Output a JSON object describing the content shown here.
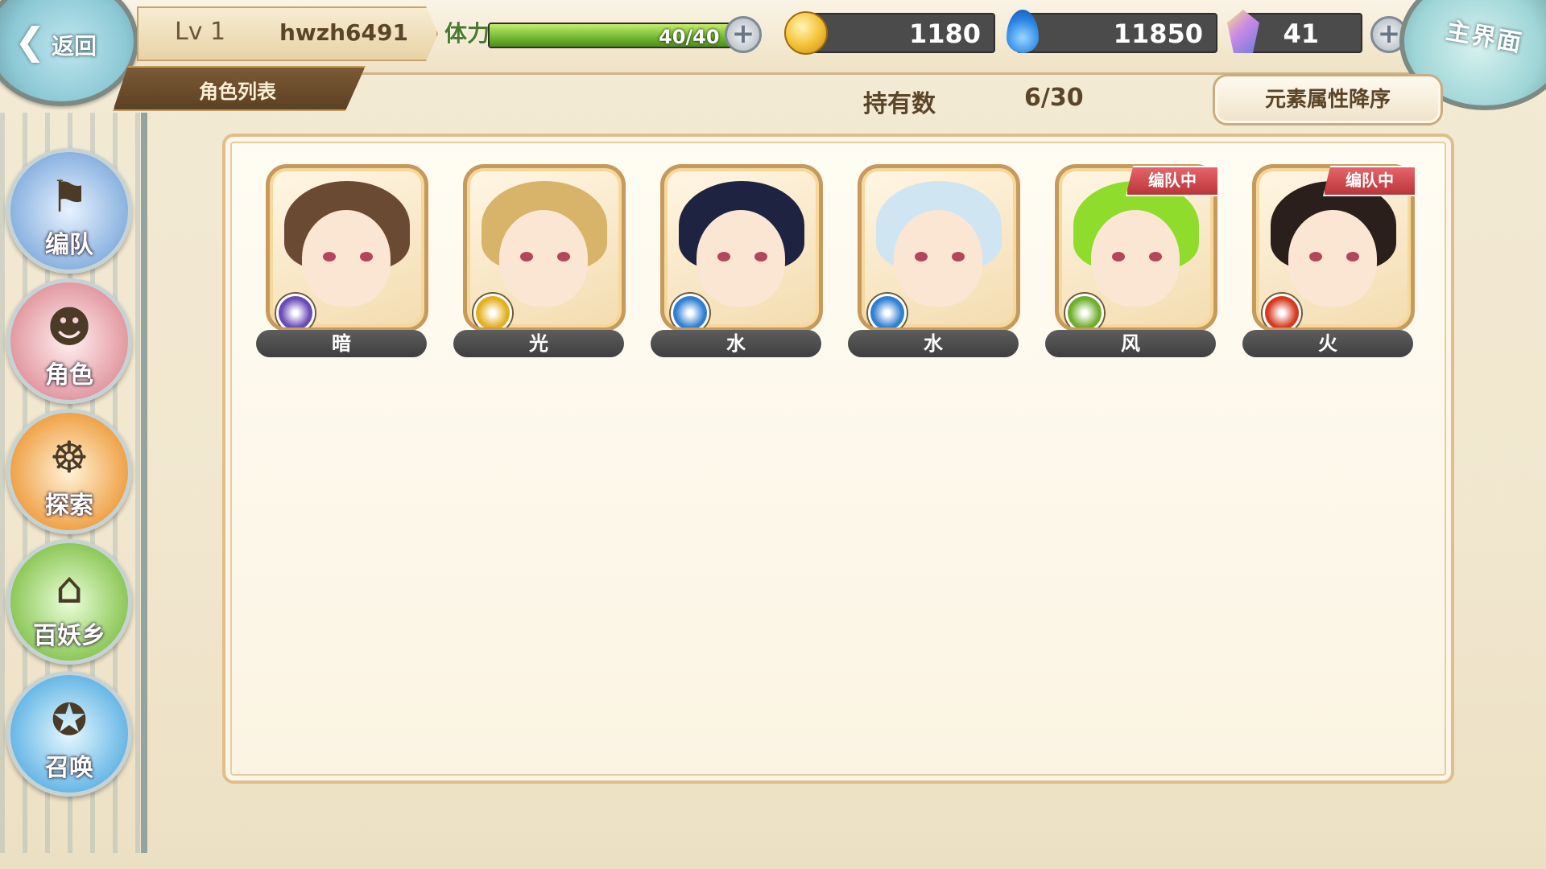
{
  "header": {
    "back_label": "返回",
    "home_label": "主界面",
    "level": "Lv 1",
    "username": "hwzh6491",
    "page_title": "角色列表",
    "stamina_label": "体力",
    "stamina_text": "40/40",
    "stamina_fraction": 1.0,
    "gold": "1180",
    "soul": "11850",
    "crystal": "41"
  },
  "toolbar": {
    "owned_label": "持有数",
    "owned_value": "6/30",
    "sort_label": "元素属性降序"
  },
  "sidebar": {
    "items": [
      {
        "label": "编队",
        "icon": "team-icon"
      },
      {
        "label": "角色",
        "icon": "character-icon"
      },
      {
        "label": "探索",
        "icon": "explore-icon"
      },
      {
        "label": "百妖乡",
        "icon": "village-icon"
      },
      {
        "label": "召唤",
        "icon": "summon-icon"
      }
    ]
  },
  "characters": [
    {
      "element": "暗",
      "in_team": false,
      "team_tag": "",
      "badge_color": "#6a4bb8",
      "hair_color": "#6b4a34"
    },
    {
      "element": "光",
      "in_team": false,
      "team_tag": "",
      "badge_color": "#e3b01e",
      "hair_color": "#d8b46a"
    },
    {
      "element": "水",
      "in_team": false,
      "team_tag": "",
      "badge_color": "#2f7fd3",
      "hair_color": "#1d2340"
    },
    {
      "element": "水",
      "in_team": false,
      "team_tag": "",
      "badge_color": "#2f7fd3",
      "hair_color": "#cfe6f2"
    },
    {
      "element": "风",
      "in_team": true,
      "team_tag": "编队中",
      "badge_color": "#6fae2a",
      "hair_color": "#8fdc2c"
    },
    {
      "element": "火",
      "in_team": true,
      "team_tag": "编队中",
      "badge_color": "#d6391e",
      "hair_color": "#2a1f1a"
    }
  ]
}
